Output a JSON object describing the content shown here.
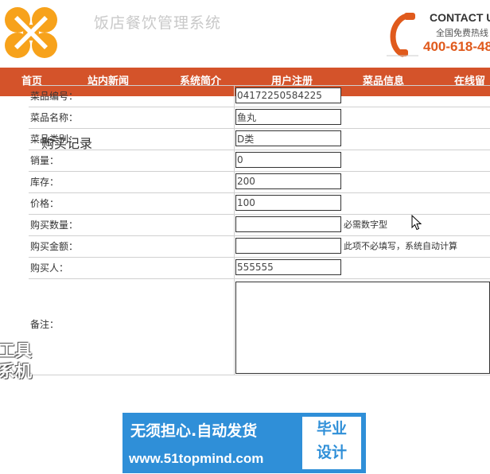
{
  "header": {
    "site_title": "饭店餐饮管理系统",
    "contact_title": "CONTACT U",
    "contact_sub": "全国免费热线",
    "contact_phone": "400-618-48"
  },
  "nav": {
    "items": [
      "首页",
      "站内新闻",
      "系统简介",
      "用户注册",
      "菜品信息",
      "在线留"
    ]
  },
  "main": {
    "title": "购买记录",
    "fields": [
      {
        "label": "菜品编号：",
        "value": "04172250584225"
      },
      {
        "label": "菜品名称：",
        "value": "鱼丸"
      },
      {
        "label": "菜品类别：",
        "value": "D类"
      },
      {
        "label": "销量：",
        "value": "0"
      },
      {
        "label": "库存：",
        "value": "200"
      },
      {
        "label": "价格：",
        "value": "100"
      },
      {
        "label": "购买数量：",
        "value": "",
        "hint": "必需数字型"
      },
      {
        "label": "购买金额：",
        "value": "",
        "hint": "此项不必填写，系统自动计算"
      },
      {
        "label": "购买人：",
        "value": "555555"
      }
    ],
    "notes_label": "备注："
  },
  "overlay": {
    "side_text_1": "工具",
    "side_text_2": "系机",
    "ad_main": "无须担心.自动发货",
    "ad_url": "www.51topmind.com",
    "ad_box_1": "毕业",
    "ad_box_2": "设计"
  },
  "colors": {
    "nav_bg": "#d4532a",
    "phone_accent": "#e05a1c",
    "ad_bg": "#2f8fd8",
    "logo_orange": "#f5a623"
  }
}
